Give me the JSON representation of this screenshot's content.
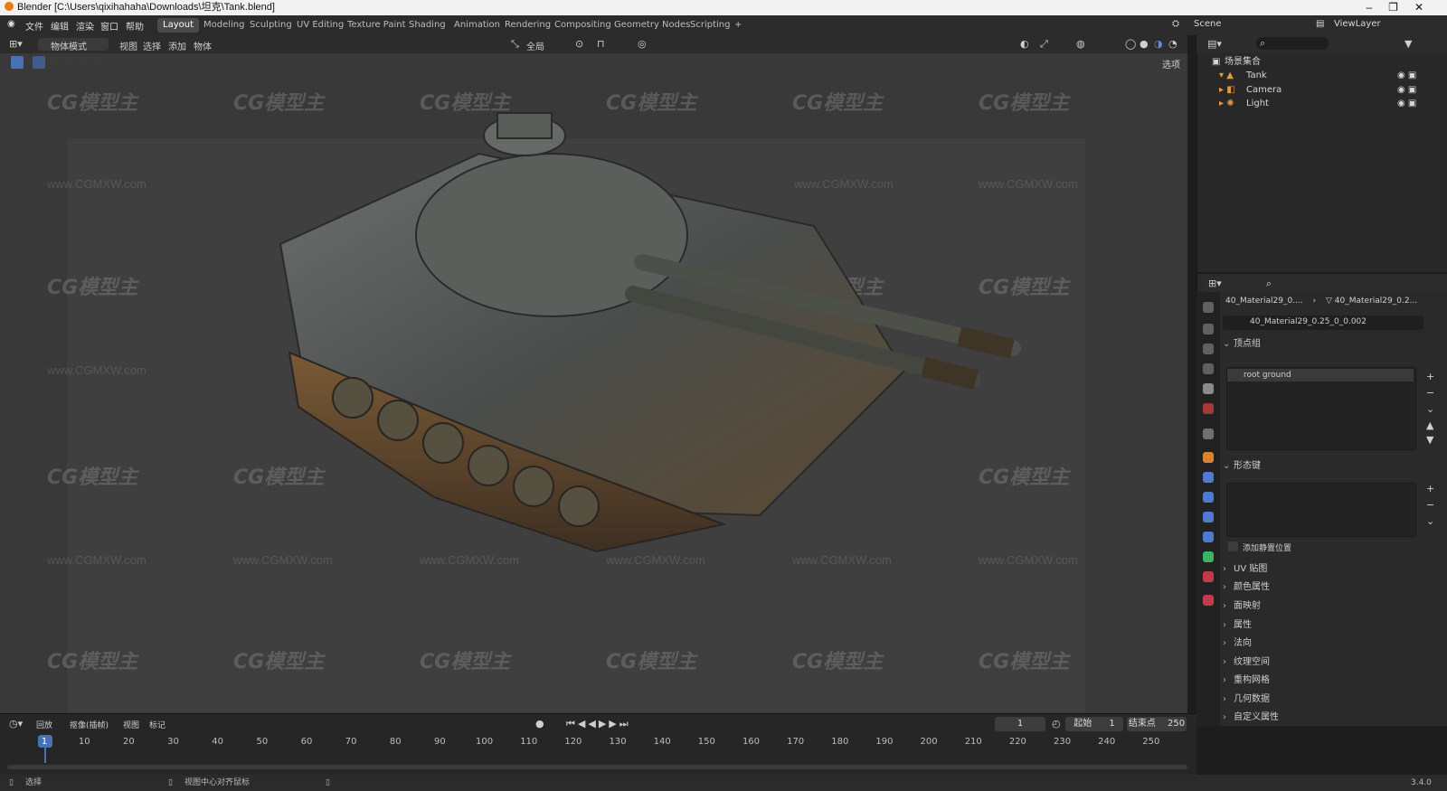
{
  "window": {
    "title": "Blender [C:\\Users\\qixihahaha\\Downloads\\坦克\\Tank.blend]",
    "controls": [
      "–",
      "❐",
      "✕"
    ]
  },
  "menu": [
    "文件",
    "编辑",
    "渲染",
    "窗口",
    "帮助"
  ],
  "workspaces": [
    "Layout",
    "Modeling",
    "Sculpting",
    "UV Editing",
    "Texture Paint",
    "Shading",
    "Animation",
    "Rendering",
    "Compositing",
    "Geometry Nodes",
    "Scripting",
    "+"
  ],
  "scene": {
    "scene_name": "Scene",
    "view_layer": "ViewLayer"
  },
  "viewport_header": {
    "mode": "物体模式",
    "menus": [
      "视图",
      "选择",
      "添加",
      "物体"
    ],
    "transform_orientation": "全局",
    "options": "选项"
  },
  "watermark": {
    "logo_text": "CG模型主",
    "url": "www.CGMXW.com"
  },
  "outliner": {
    "collection": "场景集合",
    "items": [
      {
        "name": "Tank",
        "icon": "mesh-icon"
      },
      {
        "name": "Camera",
        "icon": "camera-icon"
      },
      {
        "name": "Light",
        "icon": "light-icon"
      }
    ]
  },
  "properties": {
    "breadcrumb_object": "40_Material29_0....",
    "breadcrumb_data": "40_Material29_0.2...",
    "mesh_name": "40_Material29_0.25_0_0.002",
    "vertex_groups_label": "顶点组",
    "vertex_group_item": "root ground",
    "shape_keys_label": "形态键",
    "add_rest_position": "添加静置位置",
    "panels": [
      "UV 贴图",
      "颜色属性",
      "面映射",
      "属性",
      "法向",
      "纹理空间",
      "重构网格",
      "几何数据",
      "自定义属性"
    ]
  },
  "timeline": {
    "menus": [
      "回放",
      "抠像(插帧)",
      "视图",
      "标记"
    ],
    "current_frame": "1",
    "start_label": "起始",
    "start": "1",
    "end_label": "结束点",
    "end": "250",
    "ticks": [
      "1",
      "10",
      "20",
      "30",
      "40",
      "50",
      "60",
      "70",
      "80",
      "90",
      "100",
      "110",
      "120",
      "130",
      "140",
      "150",
      "160",
      "170",
      "180",
      "190",
      "200",
      "210",
      "220",
      "230",
      "240",
      "250"
    ]
  },
  "statusbar": {
    "select": "选择",
    "center_view": "视图中心对齐鼠标",
    "version": "3.4.0"
  }
}
